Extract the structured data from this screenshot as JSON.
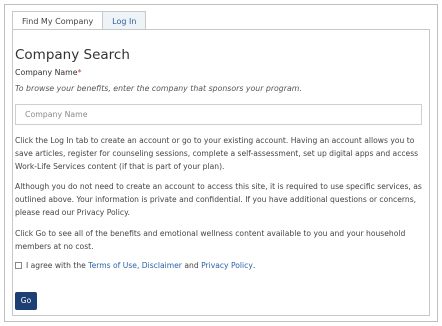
{
  "tabs": [
    {
      "label": "Find My Company",
      "active": true
    },
    {
      "label": "Log In",
      "active": false
    }
  ],
  "form": {
    "title": "Company Search",
    "field_label": "Company Name",
    "required_mark": "*",
    "hint": "To browse your benefits, enter the company that sponsors your program.",
    "input_value": "",
    "input_placeholder": "Company Name"
  },
  "paragraphs": [
    "Click the Log In tab to create an account or go to your existing account. Having an account allows you to save articles, register for counseling sessions, complete a self-assessment, set up digital apps and access Work-Life Services content (if that is part of your plan).",
    "Although you do not need to create an account to access this site, it is required to use specific services, as outlined above. Your information is private and confidential. If you have additional questions or concerns, please read our Privacy Policy.",
    "Click Go to see all of the benefits and emotional wellness content available to you and your household members at no cost."
  ],
  "agreement": {
    "checked": false,
    "prefix": "I agree with the ",
    "terms_link": "Terms of Use, Disclaimer",
    "and_text": " and ",
    "privacy_link": "Privacy Policy",
    "suffix": "."
  },
  "go_button": {
    "label": "Go"
  },
  "colors": {
    "link": "#2a62a8",
    "button_bg": "#1e3f73",
    "required": "#c0392b",
    "border": "#c8c8c8"
  }
}
